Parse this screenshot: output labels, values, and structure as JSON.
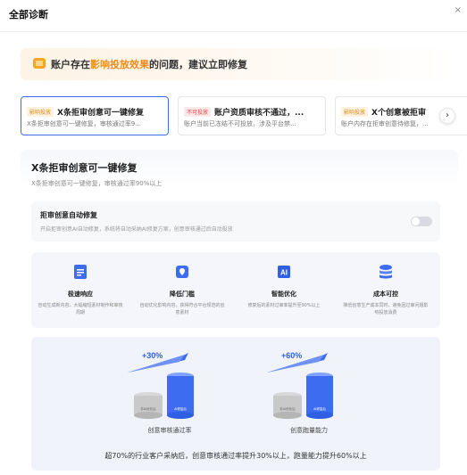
{
  "header": {
    "title": "全部诊断",
    "close": "×"
  },
  "banner": {
    "prefix": "账户存在",
    "highlight": "影响投放效果",
    "suffix": "的问题，建议立即修复"
  },
  "tabs": [
    {
      "tag": "影响投放",
      "title": "X条拒审创意可一键修复",
      "desc": "X条拒审创意可一键修复，审核通过率9..."
    },
    {
      "tag": "不可投放",
      "title": "账户资质审核不通过，...",
      "desc": "账户当前已冻结不可投放，涉及平台禁..."
    },
    {
      "tag": "影响投放",
      "title": "X个创意被拒审",
      "desc": "账户内存在拒审创意待修复，..."
    }
  ],
  "tab_arrow": "›",
  "panel": {
    "title": "X条拒审创意可一键修复",
    "subtitle": "X条拒审创意可一键修复，审核通过率90%以上",
    "auto": {
      "title": "拒审创意自动修复",
      "desc": "开启拒审创意AI自动修复，系统将自动采纳AI修复方案，创意审核通过后自动投放"
    },
    "features": [
      {
        "title": "极速响应",
        "desc": "自动生成新内容，大幅缩短素材制作和审核周期",
        "icon": "document-icon"
      },
      {
        "title": "降低门槛",
        "desc": "自动优化影响内容，获得符合平台规范的创意素材",
        "icon": "shield-icon"
      },
      {
        "title": "智能优化",
        "desc": "修复后的素材过审率提升至90%以上",
        "icon": "ai-icon"
      },
      {
        "title": "成本可控",
        "desc": "降低创意生产成本同时，避免因过审问题影响投放消费",
        "icon": "database-icon"
      }
    ],
    "results": [
      {
        "percent": "+30%",
        "before": "非AI优化后",
        "after": "AI修复后",
        "label": "创意审核通过率"
      },
      {
        "percent": "+60%",
        "before": "非AI优化后",
        "after": "AI修复后",
        "label": "创意跑量能力"
      }
    ],
    "footer": "超70%的行业客户采纳后，创意审核通过率提升30%以上，跑量能力提升60%以上"
  },
  "colors": {
    "accent": "#3d6cf0",
    "warning": "#f08c19",
    "danger": "#e54545"
  }
}
